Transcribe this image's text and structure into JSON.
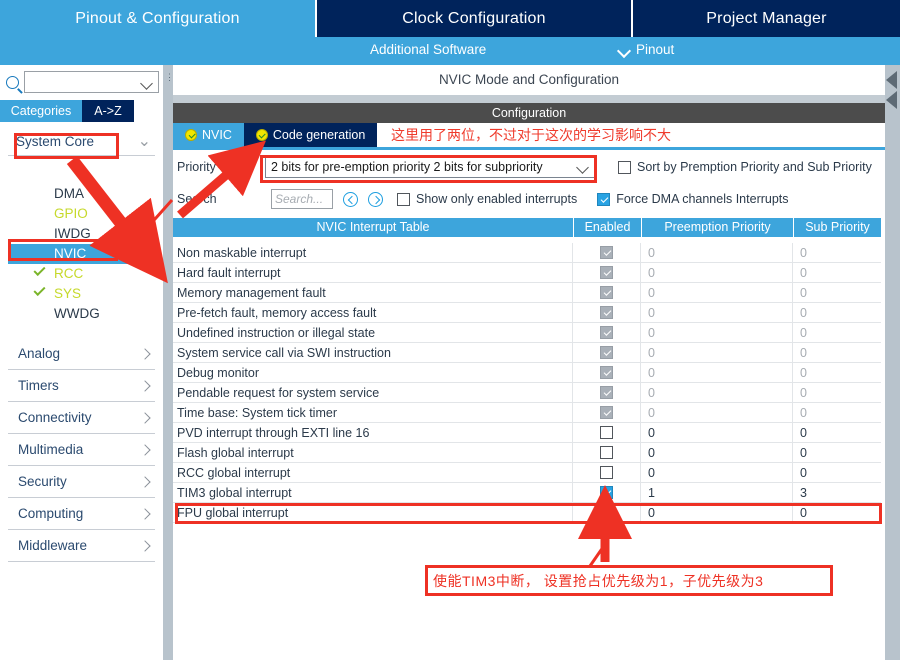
{
  "topbar": {
    "tabs": [
      {
        "label": "Pinout & Configuration",
        "selected": true
      },
      {
        "label": "Clock Configuration",
        "selected": false
      },
      {
        "label": "Project Manager",
        "selected": false
      }
    ]
  },
  "subbar": {
    "additional_software": "Additional Software",
    "pinout": "Pinout",
    "chevron_icon": "chevron-down-icon"
  },
  "sidebar": {
    "search": {
      "value": "",
      "placeholder": "",
      "icon": "search-icon"
    },
    "view_toggle": {
      "categories": "Categories",
      "az": "A->Z",
      "selected": "Categories"
    },
    "group": {
      "title": "System Core",
      "peripherals": [
        {
          "label": "DMA",
          "state": "none"
        },
        {
          "label": "GPIO",
          "state": "partial"
        },
        {
          "label": "IWDG",
          "state": "none"
        },
        {
          "label": "NVIC",
          "state": "selected"
        },
        {
          "label": "RCC",
          "state": "configured"
        },
        {
          "label": "SYS",
          "state": "configured"
        },
        {
          "label": "WWDG",
          "state": "none"
        }
      ]
    },
    "categories": [
      {
        "label": "Analog"
      },
      {
        "label": "Timers"
      },
      {
        "label": "Connectivity"
      },
      {
        "label": "Multimedia"
      },
      {
        "label": "Security"
      },
      {
        "label": "Computing"
      },
      {
        "label": "Middleware"
      }
    ]
  },
  "main": {
    "mode_title": "NVIC Mode and Configuration",
    "configuration_bar": "Configuration",
    "tabs": [
      {
        "label": "NVIC",
        "selected": true,
        "icon": "check-badge-icon"
      },
      {
        "label": "Code generation",
        "selected": false,
        "icon": "check-badge-icon"
      }
    ],
    "priority_group": {
      "label": "Priority Group",
      "value": "2 bits for pre-emption priority 2 bits for subpriority"
    },
    "sort_checkbox": {
      "label": "Sort by Premption Priority and Sub Priority",
      "checked": false
    },
    "search": {
      "label": "Search",
      "placeholder": "Search...",
      "value": "",
      "prev_icon": "chevron-left-circle-icon",
      "next_icon": "chevron-right-circle-icon"
    },
    "show_enabled_checkbox": {
      "label": "Show only enabled interrupts",
      "checked": false
    },
    "force_dma_checkbox": {
      "label": "Force DMA channels Interrupts",
      "checked": true
    },
    "table": {
      "headers": [
        "NVIC Interrupt Table",
        "Enabled",
        "Preemption Priority",
        "Sub Priority"
      ],
      "rows": [
        {
          "name": "Non maskable interrupt",
          "enabled": true,
          "locked": true,
          "preemption": "0",
          "sub": "0"
        },
        {
          "name": "Hard fault interrupt",
          "enabled": true,
          "locked": true,
          "preemption": "0",
          "sub": "0"
        },
        {
          "name": "Memory management fault",
          "enabled": true,
          "locked": true,
          "preemption": "0",
          "sub": "0"
        },
        {
          "name": "Pre-fetch fault, memory access fault",
          "enabled": true,
          "locked": true,
          "preemption": "0",
          "sub": "0"
        },
        {
          "name": "Undefined instruction or illegal state",
          "enabled": true,
          "locked": true,
          "preemption": "0",
          "sub": "0"
        },
        {
          "name": "System service call via SWI instruction",
          "enabled": true,
          "locked": true,
          "preemption": "0",
          "sub": "0"
        },
        {
          "name": "Debug monitor",
          "enabled": true,
          "locked": true,
          "preemption": "0",
          "sub": "0"
        },
        {
          "name": "Pendable request for system service",
          "enabled": true,
          "locked": true,
          "preemption": "0",
          "sub": "0"
        },
        {
          "name": "Time base: System tick timer",
          "enabled": true,
          "locked": true,
          "preemption": "0",
          "sub": "0"
        },
        {
          "name": "PVD interrupt through EXTI line 16",
          "enabled": false,
          "locked": false,
          "preemption": "0",
          "sub": "0"
        },
        {
          "name": "Flash global interrupt",
          "enabled": false,
          "locked": false,
          "preemption": "0",
          "sub": "0"
        },
        {
          "name": "RCC global interrupt",
          "enabled": false,
          "locked": false,
          "preemption": "0",
          "sub": "0"
        },
        {
          "name": "TIM3 global interrupt",
          "enabled": true,
          "locked": false,
          "preemption": "1",
          "sub": "3"
        },
        {
          "name": "FPU global interrupt",
          "enabled": false,
          "locked": false,
          "preemption": "0",
          "sub": "0"
        }
      ]
    }
  },
  "annotations": {
    "note_top": "这里用了两位，不过对于这次的学习影响不大",
    "note_bottom": "使能TIM3中断， 设置抢占优先级为1，子优先级为3",
    "highlight_color": "#ee3124"
  }
}
